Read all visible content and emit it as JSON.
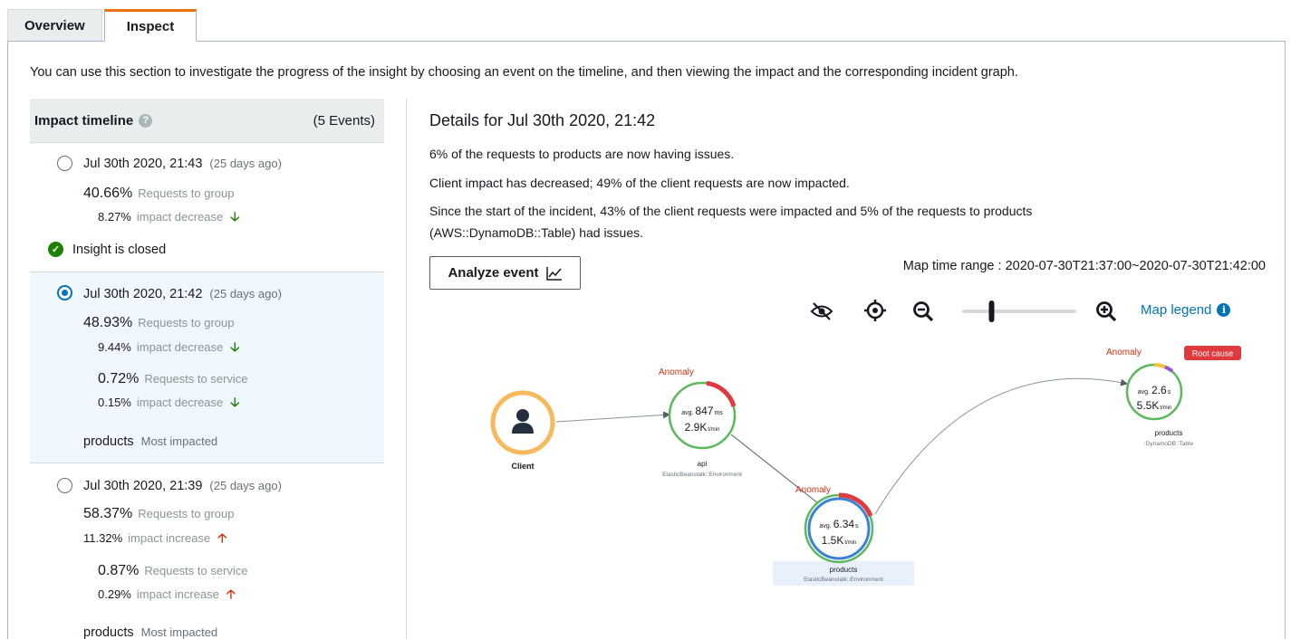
{
  "tabs": [
    {
      "label": "Overview",
      "active": false
    },
    {
      "label": "Inspect",
      "active": true
    }
  ],
  "intro": "You can use this section to investigate the progress of the insight by choosing an event on the timeline, and then viewing the impact and the corresponding incident graph.",
  "timeline": {
    "title": "Impact timeline",
    "help_icon": "question-circle-icon",
    "count": "(5 Events)",
    "events": [
      {
        "date": "Jul 30th 2020, 21:43",
        "ago": "(25 days ago)",
        "selected": false,
        "group_pct": "40.66%",
        "group_label": "Requests to group",
        "group_change_pct": "8.27%",
        "group_change_label": "impact decrease",
        "direction": "down",
        "closed_text": "Insight is closed"
      },
      {
        "date": "Jul 30th 2020, 21:42",
        "ago": "(25 days ago)",
        "selected": true,
        "group_pct": "48.93%",
        "group_label": "Requests to group",
        "group_change_pct": "9.44%",
        "group_change_label": "impact decrease",
        "service_pct": "0.72%",
        "service_label": "Requests to service",
        "service_change_pct": "0.15%",
        "service_change_label": "impact decrease",
        "direction": "down",
        "service_name": "products",
        "service_note": "Most impacted"
      },
      {
        "date": "Jul 30th 2020, 21:39",
        "ago": "(25 days ago)",
        "selected": false,
        "group_pct": "58.37%",
        "group_label": "Requests to group",
        "group_change_pct": "11.32%",
        "group_change_label": "impact increase",
        "service_pct": "0.87%",
        "service_label": "Requests to service",
        "service_change_pct": "0.29%",
        "service_change_label": "impact increase",
        "direction": "up",
        "service_name": "products",
        "service_note": "Most impacted"
      }
    ]
  },
  "details": {
    "title": "Details for Jul 30th 2020, 21:42",
    "line1": "6% of the requests to products are now having issues.",
    "line2": "Client impact has decreased; 49% of the client requests are now impacted.",
    "line3a": "Since the start of the incident, 43% of the client requests were impacted and 5% of the requests to products",
    "line3b": "(AWS::DynamoDB::Table) had issues.",
    "analyze_label": "Analyze event",
    "time_range": "Map time range : 2020-07-30T21:37:00~2020-07-30T21:42:00",
    "map_legend_label": "Map legend",
    "zoom_level": 0.25
  },
  "graph": {
    "anomaly_label": "Anomaly",
    "root_cause_label": "Root cause",
    "nodes": {
      "client": {
        "name": "Client"
      },
      "api": {
        "name": "api",
        "type": "ElasticBeanstalk::Environment",
        "avg": "avg.",
        "latency": "847",
        "latency_unit": "ms",
        "rate": "2.9K",
        "rate_unit": "t/min"
      },
      "products_eb": {
        "name": "products",
        "type": "ElasticBeanstalk::Environment",
        "avg": "avg.",
        "latency": "6.34",
        "latency_unit": "s",
        "rate": "1.5K",
        "rate_unit": "t/min"
      },
      "products_ddb": {
        "name": "products",
        "type": ":DynamoDB::Table",
        "avg": "avg.",
        "latency": "2.6",
        "latency_unit": "s",
        "rate": "5.5K",
        "rate_unit": "t/min"
      }
    }
  },
  "colors": {
    "accent": "#0073bb",
    "green": "#1d8102",
    "red": "#d13212",
    "tab_accent": "#ec7211",
    "node_ok": "#5cb85c",
    "node_client": "#f8b85c",
    "fault": "#e0393e"
  }
}
